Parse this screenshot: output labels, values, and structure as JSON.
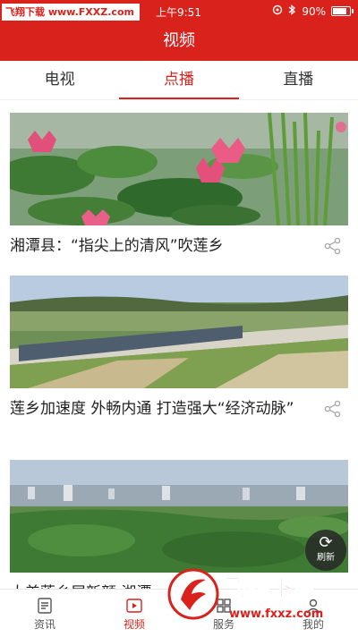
{
  "status_bar": {
    "watermark_text": "飞翔下载 www.FXXZ.com",
    "time": "上午9:51",
    "battery": "90%",
    "battery_level": 0.9
  },
  "header": {
    "title": "视频"
  },
  "tabs": [
    {
      "label": "电视"
    },
    {
      "label": "点播"
    },
    {
      "label": "直播"
    }
  ],
  "feed": [
    {
      "title": "湘潭县：“指尖上的清风”吹莲乡"
    },
    {
      "title": "莲乡加速度 外畅内通 打造强大“经济动脉”"
    },
    {
      "title": "大美莲乡展新颜 湘潭"
    }
  ],
  "refresh": {
    "label": "刷新",
    "icon": "refresh-icon"
  },
  "bottom_nav": [
    {
      "label": "资讯",
      "icon": "news-icon"
    },
    {
      "label": "视频",
      "icon": "video-icon"
    },
    {
      "label": "服务",
      "icon": "service-icon"
    },
    {
      "label": "我的",
      "icon": "profile-icon"
    }
  ],
  "brand_overlay": {
    "name": "飞翔下载",
    "url": "www.fxxz.com"
  },
  "colors": {
    "primary": "#d9221c",
    "text": "#222222",
    "muted": "#555555"
  }
}
